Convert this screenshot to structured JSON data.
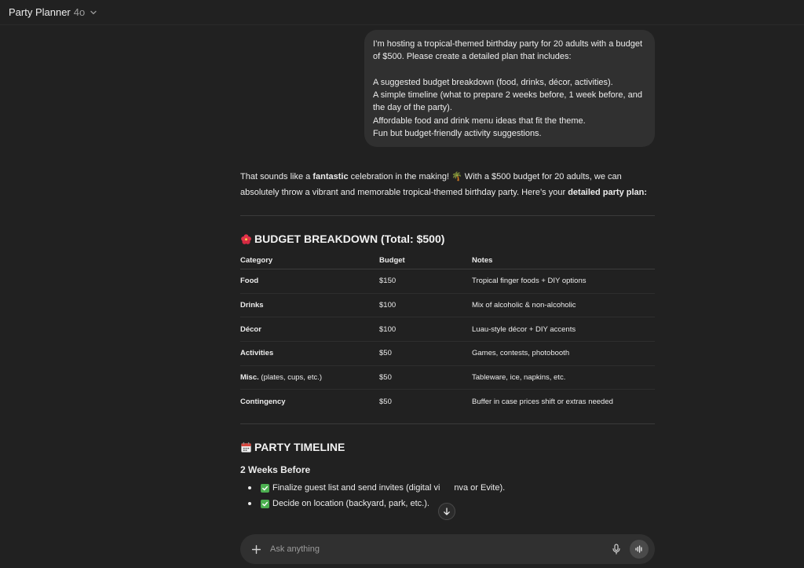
{
  "header": {
    "app_title": "Party Planner",
    "model": "4o"
  },
  "user_message": {
    "line1": "I’m hosting a tropical-themed birthday party for 20 adults with a budget of $500. Please create a detailed plan that includes:",
    "items": [
      "A suggested budget breakdown (food, drinks, décor, activities).",
      "A simple timeline (what to prepare 2 weeks before, 1 week before, and the day of the party).",
      "Affordable food and drink menu ideas that fit the theme.",
      "Fun but budget-friendly activity suggestions."
    ]
  },
  "answer": {
    "intro_a": "That sounds like a ",
    "intro_b": "fantastic",
    "intro_c": " celebration in the making! 🌴 With a $500 budget for 20 adults, we can absolutely throw a vibrant and memorable tropical-themed birthday party. Here’s your ",
    "intro_d": "detailed party plan",
    "intro_e": ":",
    "budget_heading": "BUDGET BREAKDOWN (Total: $500)",
    "table_headers": [
      "Category",
      "Budget",
      "Notes"
    ],
    "rows": [
      {
        "category": "Food",
        "extra": "",
        "budget": "$150",
        "notes": "Tropical finger foods + DIY options"
      },
      {
        "category": "Drinks",
        "extra": "",
        "budget": "$100",
        "notes": "Mix of alcoholic & non-alcoholic"
      },
      {
        "category": "Décor",
        "extra": "",
        "budget": "$100",
        "notes": "Luau-style décor + DIY accents"
      },
      {
        "category": "Activities",
        "extra": "",
        "budget": "$50",
        "notes": "Games, contests, photobooth"
      },
      {
        "category": "Misc.",
        "extra": " (plates, cups, etc.)",
        "budget": "$50",
        "notes": "Tableware, ice, napkins, etc."
      },
      {
        "category": "Contingency",
        "extra": "",
        "budget": "$50",
        "notes": "Buffer in case prices shift or extras needed"
      }
    ],
    "timeline_heading": "PARTY TIMELINE",
    "two_weeks_heading": "2 Weeks Before",
    "two_weeks_items": [
      "Finalize guest list and send invites (digital vi",
      "Decide on location (backyard, park, etc.)."
    ],
    "first_item_tail": "nva or Evite)."
  },
  "composer": {
    "placeholder": "Ask anything"
  },
  "icons": {
    "chevron": "chevron-down-icon",
    "hibiscus": "hibiscus-emoji-icon",
    "calendar": "calendar-emoji-icon",
    "check": "check-box-icon",
    "scroll": "arrow-down-icon",
    "plus": "plus-icon",
    "mic": "microphone-icon",
    "voice": "voice-mode-icon"
  },
  "colors": {
    "background": "#212121",
    "bubble": "#303030",
    "text": "#ececec",
    "check_green": "#4caf50"
  }
}
